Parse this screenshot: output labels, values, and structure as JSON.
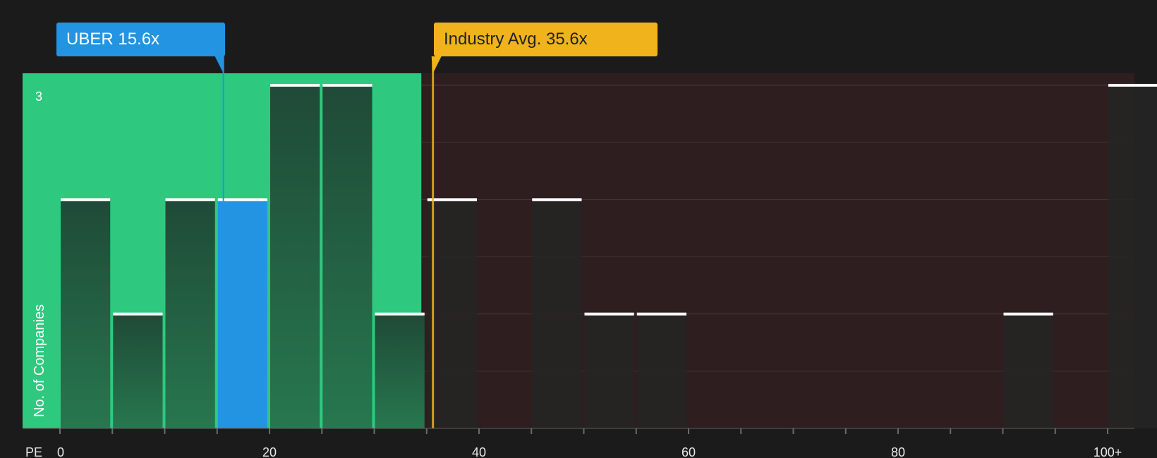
{
  "callouts": {
    "company": "UBER 15.6x",
    "industry": "Industry Avg. 35.6x"
  },
  "colors": {
    "background": "#1b1b1c",
    "fair_zone": "#2ec97e",
    "expensive_zone": "#2e1e1f",
    "company": "#2394e2",
    "industry": "#f0b31c",
    "bar": "#252424",
    "bar_cap": "#ffffff"
  },
  "chart_data": {
    "type": "bar",
    "xlabel": "PE",
    "ylabel": "No. of Companies",
    "xlim": [
      0,
      102.5
    ],
    "ylim": [
      0,
      3.1
    ],
    "x_tick_labels": [
      {
        "value": 0,
        "label": "0"
      },
      {
        "value": 20,
        "label": "20"
      },
      {
        "value": 40,
        "label": "40"
      },
      {
        "value": 60,
        "label": "60"
      },
      {
        "value": 80,
        "label": "80"
      },
      {
        "value": 100,
        "label": "100+"
      }
    ],
    "y_tick_labels": [
      {
        "value": 3,
        "label": "3"
      }
    ],
    "bin_width": 5,
    "bins": [
      {
        "start": 0,
        "count": 2
      },
      {
        "start": 5,
        "count": 1
      },
      {
        "start": 10,
        "count": 2
      },
      {
        "start": 15,
        "count": 2
      },
      {
        "start": 20,
        "count": 3
      },
      {
        "start": 25,
        "count": 3
      },
      {
        "start": 30,
        "count": 1
      },
      {
        "start": 35,
        "count": 2
      },
      {
        "start": 45,
        "count": 2
      },
      {
        "start": 50,
        "count": 1
      },
      {
        "start": 55,
        "count": 1
      },
      {
        "start": 90,
        "count": 1
      },
      {
        "start": 100,
        "count": 3
      }
    ],
    "company_value": 15.6,
    "industry_value": 35.6,
    "fair_zone_end": 34.5,
    "grid": true
  }
}
